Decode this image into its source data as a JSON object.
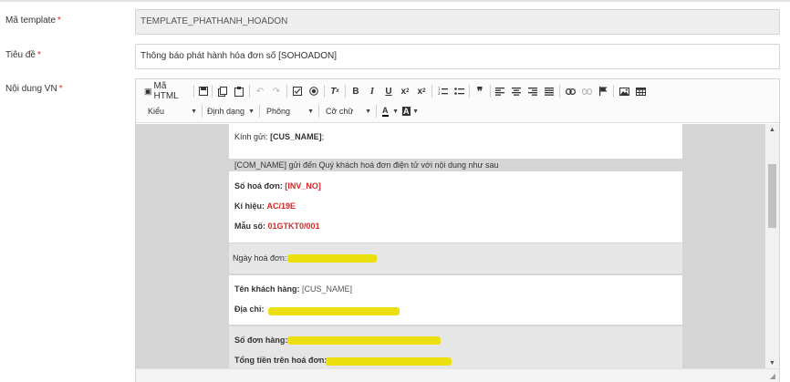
{
  "labels": {
    "template_code": "Mã template",
    "title": "Tiêu đề",
    "content_vn": "Nội dung VN",
    "required_mark": "*"
  },
  "fields": {
    "template_code_value": "TEMPLATE_PHATHANH_HOADON",
    "title_value": "Thông báo phát hành hóa đơn số [SOHOADON]"
  },
  "toolbar": {
    "source_label": "Mã HTML",
    "style_label": "Kiểu",
    "format_label": "Định dạng",
    "font_label": "Phông",
    "size_label": "Cỡ chữ",
    "text_color_glyph": "A",
    "bg_color_glyph": "A"
  },
  "email": {
    "greeting_label": "Kính gửi:",
    "greeting_value": "[CUS_NAME]",
    "greeting_tail": ";",
    "intro": "[COM_NAME] gửi đến Quý khách hoá đơn điện tử với nội dung như sau",
    "inv_no_label": "Số hoá đơn:",
    "inv_no_value": "[INV_NO]",
    "serial_label": "Kí hiệu:",
    "serial_value": "AC/19E",
    "form_label": "Mẫu số:",
    "form_value": "01GTKT0/001",
    "date_label": "Ngày hoá đơn:",
    "customer_label": "Tên khách hàng:",
    "customer_value": "[CUS_NAME]",
    "address_label": "Địa chỉ:",
    "order_label": "Số đơn hàng:",
    "total_label": "Tổng tiền trên hoá đơn:"
  },
  "colors": {
    "required": "#d9262c",
    "variable_red": "#d62828",
    "highlight": "#ecdf0f"
  }
}
